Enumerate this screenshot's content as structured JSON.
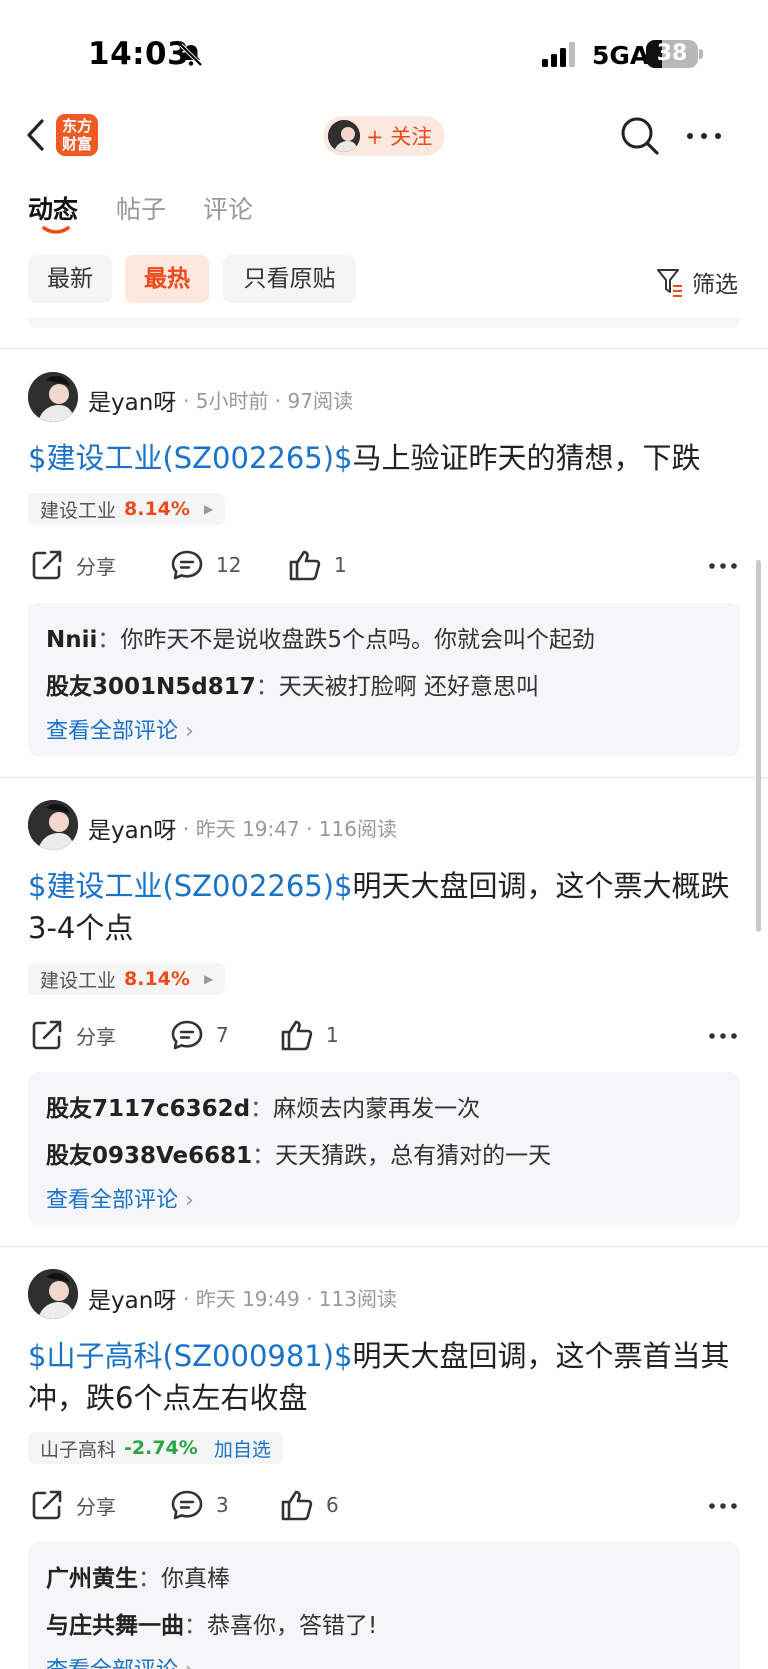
{
  "status_bar": {
    "time": "14:03",
    "network": "5GA",
    "battery": "38"
  },
  "header": {
    "logo_line1": "东方",
    "logo_line2": "财富",
    "follow_label": "+ 关注"
  },
  "tabs": [
    {
      "label": "动态"
    },
    {
      "label": "帖子"
    },
    {
      "label": "评论"
    }
  ],
  "filters": {
    "chips": [
      "最新",
      "最热",
      "只看原贴"
    ],
    "filter_label": "筛选"
  },
  "colors": {
    "accent": "#f04a1a",
    "link": "#1a73c9",
    "up": "#f04a1a",
    "down": "#27a744"
  },
  "posts": [
    {
      "user": "是yan呀",
      "time": "5小时前",
      "reads": "97阅读",
      "tag": "$建设工业(SZ002265)$",
      "text": "马上验证昨天的猜想，下跌",
      "stock": {
        "name": "建设工业",
        "change": "8.14%",
        "extra": ""
      },
      "share": "分享",
      "comments": "12",
      "likes": "1",
      "comment_list": [
        {
          "who": "Nnii",
          "text": "你昨天不是说收盘跌5个点吗。你就会叫个起劲"
        },
        {
          "who": "股友3001N5d817",
          "text": "天天被打脸啊 还好意思叫"
        }
      ],
      "view_all": "查看全部评论"
    },
    {
      "user": "是yan呀",
      "time": "昨天 19:47",
      "reads": "116阅读",
      "tag": "$建设工业(SZ002265)$",
      "text": "明天大盘回调，这个票大概跌3-4个点",
      "stock": {
        "name": "建设工业",
        "change": "8.14%",
        "extra": ""
      },
      "share": "分享",
      "comments": "7",
      "likes": "1",
      "comment_list": [
        {
          "who": "股友7117c6362d",
          "text": "麻烦去内蒙再发一次"
        },
        {
          "who": "股友0938Ve6681",
          "text": "天天猜跌，总有猜对的一天"
        }
      ],
      "view_all": "查看全部评论"
    },
    {
      "user": "是yan呀",
      "time": "昨天 19:49",
      "reads": "113阅读",
      "tag": "$山子高科(SZ000981)$",
      "text": "明天大盘回调，这个票首当其冲，跌6个点左右收盘",
      "stock": {
        "name": "山子高科",
        "change": "-2.74%",
        "extra": "加自选"
      },
      "share": "分享",
      "comments": "3",
      "likes": "6",
      "comment_list": [
        {
          "who": "广州黄生",
          "text": "你真棒"
        },
        {
          "who": "与庄共舞一曲",
          "text": "恭喜你，答错了!"
        }
      ],
      "view_all": "查看全部评论"
    }
  ],
  "separator": " · ",
  "colon": "："
}
